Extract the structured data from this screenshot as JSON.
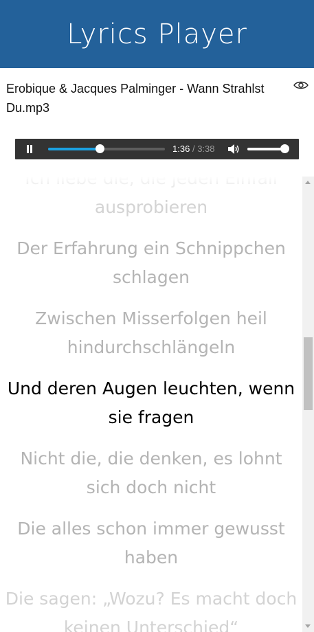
{
  "app": {
    "title": "Lyrics Player"
  },
  "track": {
    "filename": "Erobique & Jacques Palminger - Wann Strahlst Du.mp3"
  },
  "player": {
    "current_time": "1:36",
    "separator": "/",
    "duration": "3:38",
    "progress_fraction": 0.44,
    "volume_fraction": 1.0
  },
  "lyrics": {
    "lines": [
      {
        "text": "Ich liebe die, die jeden Einfall ausprobieren",
        "state": "fade"
      },
      {
        "text": "Der Erfahrung ein Schnippchen schlagen",
        "state": "inactive"
      },
      {
        "text": "Zwischen Misserfolgen heil hindurchschlängeln",
        "state": "inactive"
      },
      {
        "text": "Und deren Augen leuchten, wenn sie fragen",
        "state": "active"
      },
      {
        "text": "Nicht die, die denken, es lohnt sich doch nicht",
        "state": "inactive"
      },
      {
        "text": "Die alles schon immer gewusst haben",
        "state": "inactive"
      },
      {
        "text": "Die sagen: „Wozu? Es macht doch keinen Unterschied“",
        "state": "fade"
      }
    ]
  },
  "icons": {
    "eye": "eye-icon",
    "pause": "pause-icon",
    "volume": "speaker-icon"
  },
  "colors": {
    "header_bg": "#23619a",
    "player_bg": "#333333",
    "progress_accent": "#1ba1e2",
    "lyric_active": "#000000",
    "lyric_inactive": "#b4b4b4"
  }
}
